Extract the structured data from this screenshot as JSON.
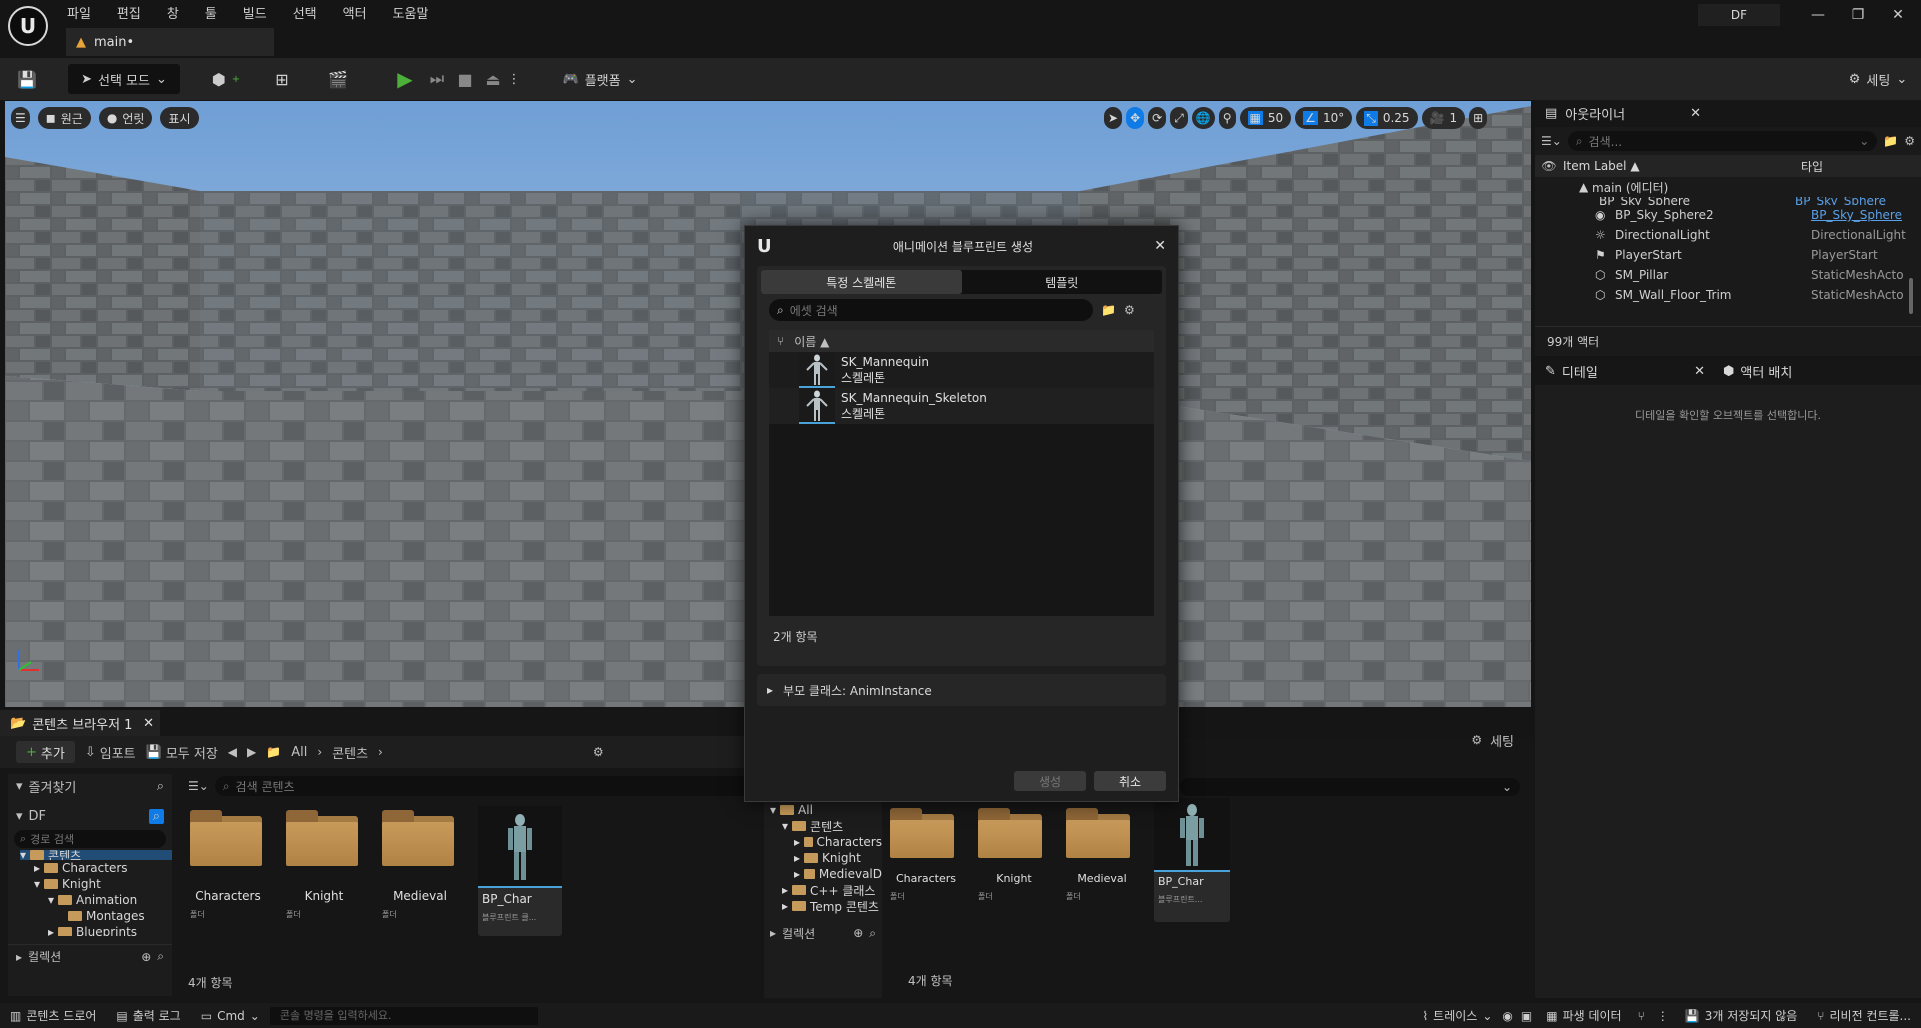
{
  "menu": [
    "파일",
    "편집",
    "창",
    "툴",
    "빌드",
    "선택",
    "액터",
    "도움말"
  ],
  "project_badge": "DF",
  "window_controls": {
    "minimize": "—",
    "restore": "❐",
    "close": "✕"
  },
  "level_tab": "main•",
  "toolbar": {
    "mode_label": "선택 모드",
    "platforms_label": "플랫폼",
    "settings_label": "세팅"
  },
  "viewport": {
    "perspective": "원근",
    "lit": "언릿",
    "show": "표시",
    "grid_snap": "50",
    "rot_snap": "10°",
    "scale_snap": "0.25",
    "camera_speed": "1"
  },
  "outliner": {
    "title": "아웃라이너",
    "search_placeholder": "검색...",
    "col_label": "Item Label ▲",
    "col_type": "타입",
    "root": "main (에디터)",
    "rows": [
      {
        "name": "BP_Sky_Sphere",
        "type": "BP_Sky_Sphere"
      },
      {
        "name": "BP_Sky_Sphere2",
        "type": "BP_Sky_Sphere"
      },
      {
        "name": "DirectionalLight",
        "type": "DirectionalLight"
      },
      {
        "name": "PlayerStart",
        "type": "PlayerStart"
      },
      {
        "name": "SM_Pillar",
        "type": "StaticMeshActo"
      },
      {
        "name": "SM_Wall_Floor_Trim",
        "type": "StaticMeshActo"
      }
    ],
    "count": "99개 액터"
  },
  "details": {
    "tab1": "디테일",
    "tab2": "액터 배치",
    "empty_msg": "디테일을 확인할 오브젝트를 선택합니다."
  },
  "content_browser": {
    "tab": "콘텐츠 브라우저 1",
    "add": "추가",
    "import": "임포트",
    "save_all": "모두 저장",
    "path_all": "All",
    "path_content": "콘텐츠",
    "settings": "세팅",
    "favorites": "즐겨찾기",
    "project": "DF",
    "path_search_placeholder": "경로 검색",
    "search_placeholder": "검색 콘텐츠",
    "tree": [
      "콘텐츠",
      "Characters",
      "Knight",
      "Animation",
      "Montages",
      "Blueprints"
    ],
    "collections": "컬렉션",
    "assets": [
      {
        "name": "Characters",
        "type": "폴더"
      },
      {
        "name": "Knight",
        "type": "폴더"
      },
      {
        "name": "Medieval Dungeon",
        "type": "폴더"
      },
      {
        "name": "BP_Char",
        "type": "블루프린트 클..."
      }
    ],
    "count": "4개 항목"
  },
  "content_browser2": {
    "project": "DF",
    "tree": [
      "All",
      "콘텐츠",
      "Characters",
      "Knight",
      "MedievalD",
      "C++ 클래스",
      "Temp 콘텐츠"
    ],
    "collections": "컬렉션",
    "assets": [
      {
        "name": "Characters",
        "type": "폴더"
      },
      {
        "name": "Knight",
        "type": "폴더"
      },
      {
        "name": "Medieval Dungeon",
        "type": "폴더"
      },
      {
        "name": "BP_Char",
        "type": "블루프린트..."
      }
    ],
    "count": "4개 항목",
    "settings": "세팅"
  },
  "dialog": {
    "title": "애니메이션 블루프린트 생성",
    "tab_skeleton": "특정 스켈레톤",
    "tab_template": "템플릿",
    "search_placeholder": "에셋 검색",
    "col_name": "이름 ▲",
    "items": [
      {
        "name": "SK_Mannequin",
        "type": "스켈레톤"
      },
      {
        "name": "SK_Mannequin_Skeleton",
        "type": "스켈레톤"
      }
    ],
    "count": "2개 항목",
    "parent_class": "부모 클래스: AnimInstance",
    "create": "생성",
    "cancel": "취소"
  },
  "statusbar": {
    "content_drawer": "콘텐츠 드로어",
    "output_log": "출력 로그",
    "cmd": "Cmd",
    "cmd_placeholder": "콘솔 명령을 입력하세요.",
    "trace": "트레이스",
    "derived_data": "파생 데이터",
    "unsaved": "3개 저장되지 않음",
    "revision": "리비전 컨트롤..."
  },
  "colors": {
    "accent": "#0e7be6",
    "play_green": "#4caf3a",
    "dialog_bg": "#1e1e1e"
  }
}
